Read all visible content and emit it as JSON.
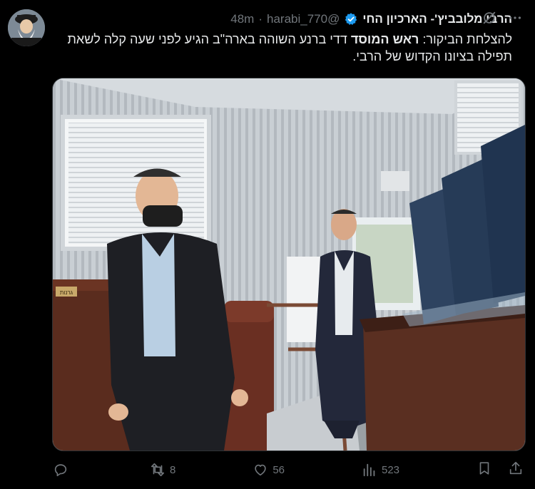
{
  "author": {
    "display_name": "הרבי מלובביץ'- הארכיון החי",
    "handle": "@harabi_770",
    "separator": "·",
    "time": "48m"
  },
  "tweet": {
    "text_prefix": "להצלחת הביקור: ",
    "text_bold": "ראש המוסד",
    "text_rest": " דדי ברנע השוהה בארה\"ב הגיע לפני שעה קלה לשאת תפילה בציונו הקדוש של הרבי."
  },
  "media": {
    "sign_text": "גרנות"
  },
  "actions": {
    "reply_count": "",
    "retweet_count": "8",
    "like_count": "56",
    "views_count": "523"
  },
  "icons": {
    "verified": "verified-badge-icon",
    "grok": "grok-icon",
    "more": "more-icon",
    "reply": "reply-icon",
    "retweet": "retweet-icon",
    "like": "like-icon",
    "views": "views-icon",
    "bookmark": "bookmark-icon",
    "share": "share-icon"
  },
  "colors": {
    "background": "#000000",
    "text": "#e7e9ea",
    "muted": "#71767b",
    "verified": "#1d9bf0"
  }
}
